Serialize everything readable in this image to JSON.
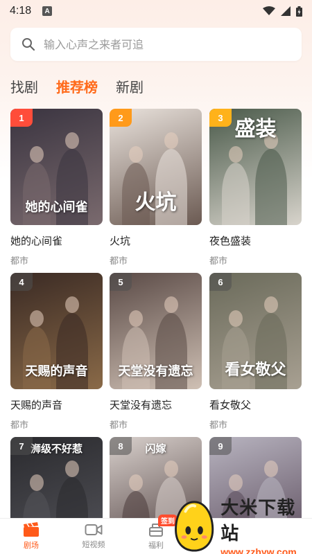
{
  "status_bar": {
    "time": "4:18",
    "notif_letter": "A"
  },
  "search": {
    "placeholder": "输入心声之来者可追",
    "value": ""
  },
  "tabs": [
    {
      "label": "找剧",
      "active": false
    },
    {
      "label": "推荐榜",
      "active": true
    },
    {
      "label": "新剧",
      "active": false
    }
  ],
  "dramas": [
    {
      "rank": "1",
      "title": "她的心间雀",
      "tag": "都市",
      "poster_text": "她的心间雀",
      "rank_color": "#ff4d3a",
      "bg": [
        "#3a3440",
        "#7a6a6e"
      ]
    },
    {
      "rank": "2",
      "title": "火坑",
      "tag": "都市",
      "poster_text": "火坑",
      "rank_color": "#ff9a1a",
      "bg": [
        "#e9e2dc",
        "#6b5a52"
      ]
    },
    {
      "rank": "3",
      "title": "夜色盛装",
      "tag": "都市",
      "poster_text": "盛装",
      "rank_color": "#ffb21a",
      "bg": [
        "#4a5a4a",
        "#d8d4cc"
      ]
    },
    {
      "rank": "4",
      "title": "天赐的声音",
      "tag": "都市",
      "poster_text": "天赐的声音",
      "rank_color": "",
      "bg": [
        "#3a2a24",
        "#8a6a48"
      ]
    },
    {
      "rank": "5",
      "title": "天堂没有遗忘",
      "tag": "都市",
      "poster_text": "天堂没有遗忘",
      "rank_color": "",
      "bg": [
        "#5a4a46",
        "#cfc0b4"
      ]
    },
    {
      "rank": "6",
      "title": "看女敬父",
      "tag": "都市",
      "poster_text": "看女敬父",
      "rank_color": "",
      "bg": [
        "#6a6a5a",
        "#a8a092"
      ]
    },
    {
      "rank": "7",
      "title": "",
      "tag": "",
      "poster_text": "浉级不好惹",
      "rank_color": "",
      "bg": [
        "#2a2a2e",
        "#54545a"
      ]
    },
    {
      "rank": "8",
      "title": "",
      "tag": "",
      "poster_text": "闪嫁",
      "rank_color": "",
      "bg": [
        "#d8d0cc",
        "#4a3a3a"
      ]
    },
    {
      "rank": "9",
      "title": "",
      "tag": "",
      "poster_text": "",
      "rank_color": "",
      "bg": [
        "#b8b4c0",
        "#5a4a5a"
      ]
    }
  ],
  "bottom_nav": [
    {
      "label": "剧场",
      "icon": "clapperboard-icon",
      "active": true
    },
    {
      "label": "短视频",
      "icon": "video-camera-icon",
      "active": false
    },
    {
      "label": "福利",
      "icon": "gift-icon",
      "active": false,
      "badge": "签到"
    }
  ],
  "watermark": {
    "name": "大米下载站",
    "url": "www.zzhyw.com"
  },
  "colors": {
    "accent": "#ff6a1a",
    "rank_top": "#ff4d3a"
  }
}
